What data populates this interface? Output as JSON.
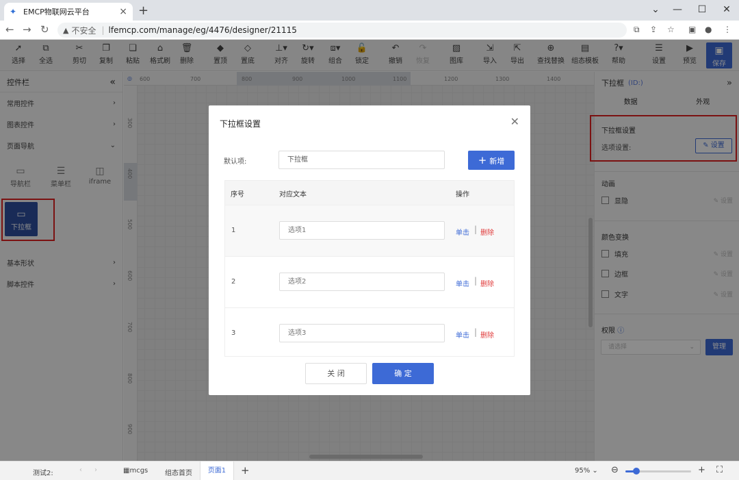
{
  "browser": {
    "tab_title": "EMCP物联网云平台",
    "insecure": "不安全",
    "url": "lfemcp.com/manage/eg/4476/designer/21115",
    "minimize": "—",
    "maximize": "☐",
    "close": "✕"
  },
  "toolbar": {
    "items": [
      {
        "label": "选择",
        "icon": "cursor-icon"
      },
      {
        "label": "全选",
        "icon": "select-all-icon"
      },
      {
        "label": "剪切",
        "icon": "scissors-icon"
      },
      {
        "label": "复制",
        "icon": "copy-icon"
      },
      {
        "label": "粘贴",
        "icon": "paste-icon"
      },
      {
        "label": "格式刷",
        "icon": "format-brush-icon"
      },
      {
        "label": "删除",
        "icon": "trash-icon"
      },
      {
        "label": "置顶",
        "icon": "bring-top-icon"
      },
      {
        "label": "置底",
        "icon": "send-bottom-icon"
      },
      {
        "label": "对齐",
        "icon": "align-icon"
      },
      {
        "label": "旋转",
        "icon": "rotate-icon"
      },
      {
        "label": "组合",
        "icon": "group-icon"
      },
      {
        "label": "锁定",
        "icon": "lock-icon"
      },
      {
        "label": "撤销",
        "icon": "undo-icon"
      },
      {
        "label": "恢复",
        "icon": "redo-icon"
      },
      {
        "label": "图库",
        "icon": "gallery-icon"
      },
      {
        "label": "导入",
        "icon": "import-icon"
      },
      {
        "label": "导出",
        "icon": "export-icon"
      },
      {
        "label": "查找替换",
        "icon": "search-replace-icon"
      },
      {
        "label": "组态模板",
        "icon": "template-icon"
      },
      {
        "label": "帮助",
        "icon": "help-icon"
      },
      {
        "label": "设置",
        "icon": "settings-icon"
      },
      {
        "label": "预览",
        "icon": "preview-icon"
      }
    ],
    "save_label": "保存"
  },
  "left_panel": {
    "title": "控件栏",
    "collapse": "«",
    "sections": [
      {
        "label": "常用控件",
        "arrow": "›"
      },
      {
        "label": "图表控件",
        "arrow": "›"
      },
      {
        "label": "页面导航",
        "arrow": "⌄"
      }
    ],
    "components": [
      {
        "label": "导航栏"
      },
      {
        "label": "菜单栏"
      },
      {
        "label": "iframe"
      },
      {
        "label": "下拉框"
      }
    ],
    "sections_after": [
      {
        "label": "基本形状",
        "arrow": "›"
      },
      {
        "label": "脚本控件",
        "arrow": "›"
      }
    ]
  },
  "ruler": {
    "h_ticks": [
      "600",
      "700",
      "800",
      "900",
      "1000",
      "1100",
      "1200",
      "1300",
      "1400"
    ],
    "v_ticks": [
      "300",
      "400",
      "500",
      "600",
      "700",
      "800",
      "900"
    ]
  },
  "right_panel": {
    "title": "下拉框",
    "id_label": "(ID:)",
    "expand": "»",
    "tabs": [
      "数据",
      "外观"
    ],
    "dropdown_settings": "下拉框设置",
    "option_settings": "选项设置:",
    "set_button": "设置",
    "animation": "动画",
    "blink": "显隐",
    "color_change": "颜色变换",
    "fill": "填充",
    "border": "边框",
    "text": "文字",
    "set_small": "设置",
    "permission": "权限",
    "select_placeholder": "请选择",
    "manage": "管理"
  },
  "bottom": {
    "test": "测试2:",
    "mcgs": "mcgs",
    "home": "组态首页",
    "page1": "页面1",
    "add": "+",
    "zoom": "95%",
    "zoom_value": 0.17
  },
  "modal": {
    "title": "下拉框设置",
    "default_label": "默认项:",
    "default_value": "下拉框",
    "add_button": "新增",
    "columns": [
      "序号",
      "对应文本",
      "操作"
    ],
    "rows": [
      {
        "no": "1",
        "text": "选项1",
        "click": "单击",
        "delete": "删除"
      },
      {
        "no": "2",
        "text": "选项2",
        "click": "单击",
        "delete": "删除"
      },
      {
        "no": "3",
        "text": "选项3",
        "click": "单击",
        "delete": "删除"
      }
    ],
    "cancel": "关 闭",
    "ok": "确 定"
  }
}
